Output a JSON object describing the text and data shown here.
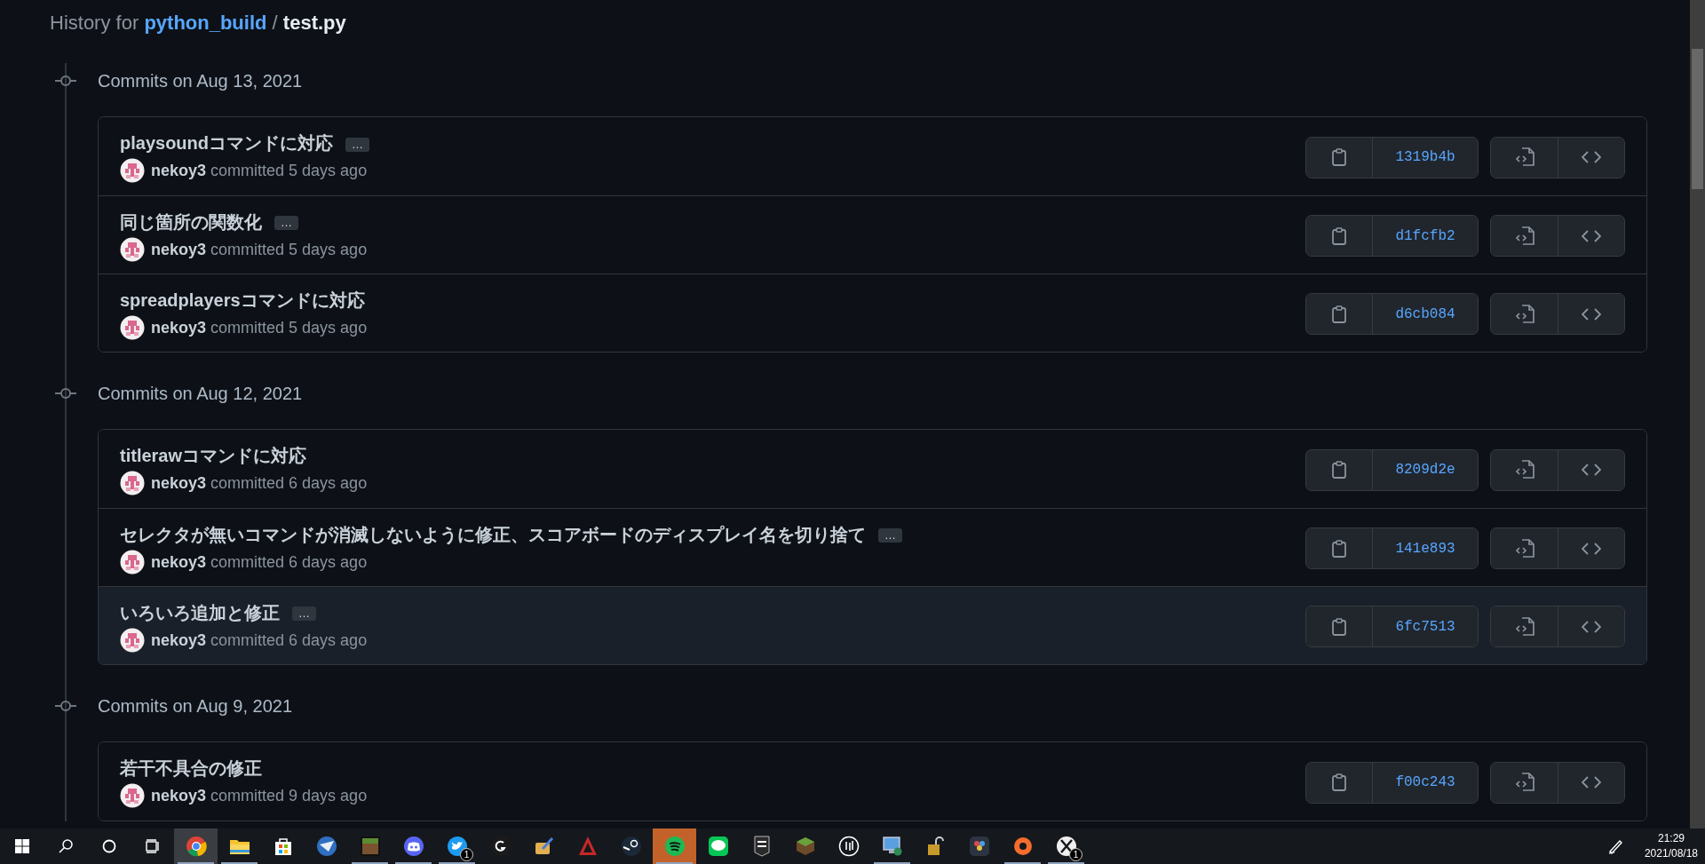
{
  "header": {
    "prefix": "History for",
    "repo": "python_build",
    "separator": "/",
    "file": "test.py"
  },
  "groups": [
    {
      "date": "Commits on Aug 13, 2021",
      "commits": [
        {
          "title": "playsoundコマンドに対応",
          "more": "…",
          "author": "nekoy3",
          "action": "committed 5 days ago",
          "sha": "1319b4b",
          "hovered": false
        },
        {
          "title": "同じ箇所の関数化",
          "more": "…",
          "author": "nekoy3",
          "action": "committed 5 days ago",
          "sha": "d1fcfb2",
          "hovered": false
        },
        {
          "title": "spreadplayersコマンドに対応",
          "author": "nekoy3",
          "action": "committed 5 days ago",
          "sha": "d6cb084",
          "hovered": false
        }
      ]
    },
    {
      "date": "Commits on Aug 12, 2021",
      "commits": [
        {
          "title": "titlerawコマンドに対応",
          "author": "nekoy3",
          "action": "committed 6 days ago",
          "sha": "8209d2e",
          "hovered": false
        },
        {
          "title": "セレクタが無いコマンドが消滅しないように修正、スコアボードのディスプレイ名を切り捨て",
          "more": "…",
          "author": "nekoy3",
          "action": "committed 6 days ago",
          "sha": "141e893",
          "hovered": false
        },
        {
          "title": "いろいろ追加と修正",
          "more": "…",
          "author": "nekoy3",
          "action": "committed 6 days ago",
          "sha": "6fc7513",
          "hovered": true
        }
      ]
    },
    {
      "date": "Commits on Aug 9, 2021",
      "commits": [
        {
          "title": "若干不具合の修正",
          "author": "nekoy3",
          "action": "committed 9 days ago",
          "sha": "f00c243",
          "hovered": false
        }
      ]
    }
  ],
  "taskbar": {
    "items": [
      {
        "active": false,
        "flashing": false,
        "running": false
      },
      {
        "active": false,
        "flashing": false,
        "running": false
      },
      {
        "active": false,
        "flashing": false,
        "running": false
      },
      {
        "active": false,
        "flashing": false,
        "running": false
      },
      {
        "active": true,
        "flashing": false,
        "running": true
      },
      {
        "active": false,
        "flashing": false,
        "running": true
      },
      {
        "active": false,
        "flashing": false,
        "running": false
      },
      {
        "active": false,
        "flashing": false,
        "running": false
      },
      {
        "active": false,
        "flashing": false,
        "running": true
      },
      {
        "active": false,
        "flashing": false,
        "running": true
      },
      {
        "active": false,
        "flashing": false,
        "running": true,
        "badge": "1"
      },
      {
        "active": false,
        "flashing": false,
        "running": false
      },
      {
        "active": false,
        "flashing": false,
        "running": false
      },
      {
        "active": false,
        "flashing": false,
        "running": false
      },
      {
        "active": false,
        "flashing": false,
        "running": false
      },
      {
        "active": false,
        "flashing": true,
        "running": true
      },
      {
        "active": false,
        "flashing": false,
        "running": false
      },
      {
        "active": false,
        "flashing": false,
        "running": false
      },
      {
        "active": false,
        "flashing": false,
        "running": false
      },
      {
        "active": false,
        "flashing": false,
        "running": false
      },
      {
        "active": false,
        "flashing": false,
        "running": true
      },
      {
        "active": false,
        "flashing": false,
        "running": false
      },
      {
        "active": false,
        "flashing": false,
        "running": false
      },
      {
        "active": false,
        "flashing": false,
        "running": true
      },
      {
        "active": false,
        "flashing": false,
        "running": true,
        "badge": "1"
      }
    ],
    "clock": {
      "time": "21:29",
      "date": "2021/08/18"
    }
  }
}
